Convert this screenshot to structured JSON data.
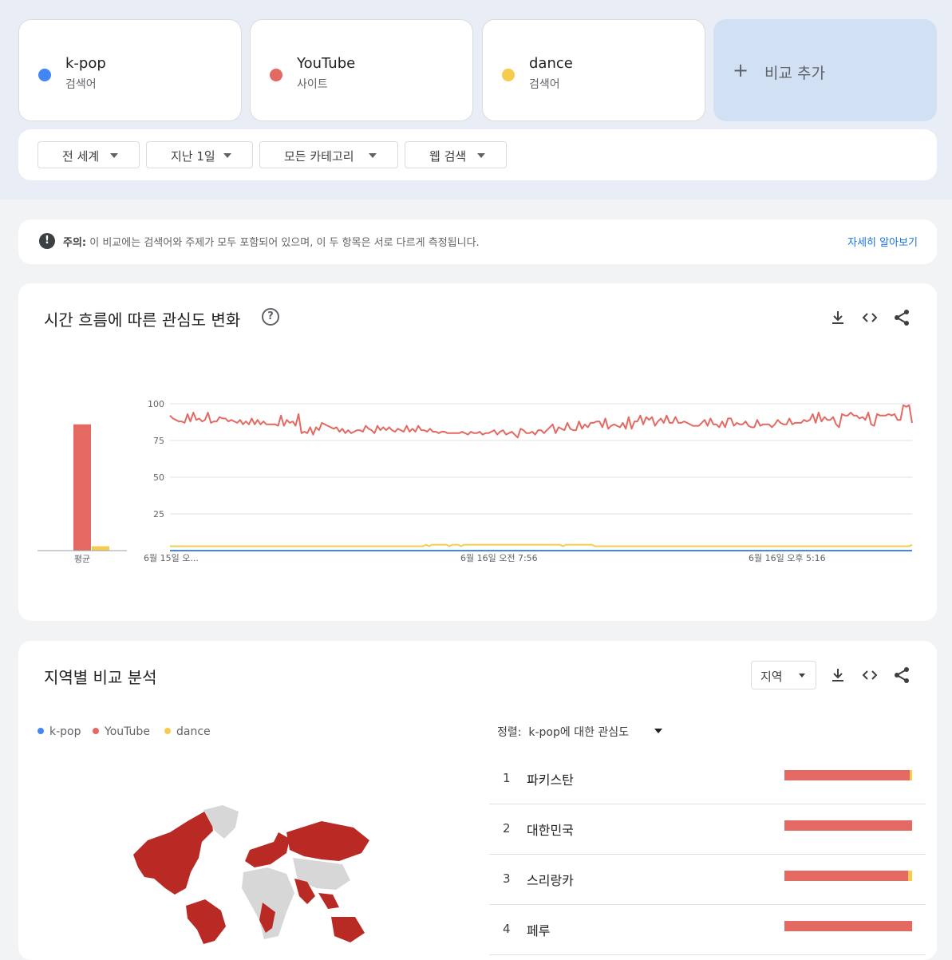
{
  "colors": {
    "kpop": "#4285f4",
    "youtube": "#e46962",
    "dance": "#f7cb4d",
    "accent": "#1a73e8"
  },
  "terms": [
    {
      "name": "k-pop",
      "type": "검색어",
      "color": "#4285f4"
    },
    {
      "name": "YouTube",
      "type": "사이트",
      "color": "#e46962"
    },
    {
      "name": "dance",
      "type": "검색어",
      "color": "#f7cb4d"
    }
  ],
  "add_compare": {
    "icon": "plus-icon",
    "label": "비교 추가"
  },
  "filters": [
    {
      "label": "전 세계"
    },
    {
      "label": "지난 1일"
    },
    {
      "label": "모든 카테고리"
    },
    {
      "label": "웹 검색"
    }
  ],
  "notice": {
    "icon": "exclamation-icon",
    "prefix": "주의:",
    "text": " 이 비교에는 검색어와 주제가 모두 포함되어 있으며, 이 두 항목은 서로 다르게 측정됩니다.",
    "link": "자세히 알아보기"
  },
  "interest_over_time": {
    "title": "시간 흐름에 따른 관심도 변화",
    "help_icon": "help-circle-icon",
    "tools": [
      "download-icon",
      "embed-code-icon",
      "share-icon"
    ]
  },
  "chart_data": {
    "type": "line",
    "y_ticks": [
      "100",
      "75",
      "50",
      "25"
    ],
    "ylim": [
      0,
      100
    ],
    "grid": true,
    "x_tick_labels": [
      "6월 15일 오...",
      "6월 16일 오전 7:56",
      "6월 16일 오후 5:16"
    ],
    "average": {
      "label": "평균",
      "values": [
        {
          "name": "k-pop",
          "value": 0
        },
        {
          "name": "YouTube",
          "value": 86
        },
        {
          "name": "dance",
          "value": 3
        }
      ]
    },
    "series": [
      {
        "name": "YouTube",
        "color": "#e46962",
        "values": [
          92,
          90,
          89,
          88,
          88,
          87,
          93,
          88,
          94,
          89,
          90,
          88,
          89,
          94,
          87,
          88,
          88,
          91,
          90,
          90,
          88,
          89,
          88,
          87,
          89,
          86,
          88,
          86,
          90,
          86,
          89,
          86,
          88,
          86,
          86,
          86,
          86,
          85,
          92,
          85,
          89,
          87,
          88,
          85,
          93,
          80,
          81,
          80,
          84,
          79,
          84,
          82,
          87,
          86,
          85,
          84,
          83,
          84,
          81,
          83,
          80,
          82,
          80,
          81,
          82,
          82,
          81,
          85,
          83,
          82,
          80,
          85,
          82,
          84,
          82,
          84,
          82,
          81,
          83,
          82,
          81,
          85,
          81,
          83,
          81,
          85,
          82,
          82,
          81,
          83,
          81,
          81,
          80,
          81,
          81,
          80,
          80,
          80,
          80,
          80,
          81,
          80,
          79,
          81,
          80,
          80,
          81,
          79,
          80,
          80,
          81,
          82,
          79,
          81,
          82,
          79,
          80,
          81,
          79,
          77,
          83,
          82,
          80,
          80,
          81,
          79,
          82,
          82,
          80,
          82,
          84,
          86,
          80,
          84,
          83,
          82,
          87,
          83,
          82,
          82,
          88,
          83,
          86,
          84,
          87,
          87,
          88,
          88,
          84,
          90,
          83,
          85,
          86,
          85,
          84,
          87,
          83,
          91,
          83,
          88,
          88,
          92,
          86,
          91,
          89,
          91,
          85,
          88,
          90,
          87,
          92,
          87,
          87,
          91,
          87,
          87,
          88,
          87,
          86,
          85,
          85,
          85,
          87,
          89,
          85,
          90,
          86,
          86,
          84,
          88,
          84,
          90,
          90,
          85,
          87,
          86,
          86,
          88,
          85,
          84,
          84,
          89,
          85,
          86,
          86,
          86,
          84,
          86,
          89,
          87,
          86,
          86,
          90,
          86,
          87,
          87,
          87,
          89,
          88,
          89,
          93,
          87,
          94,
          88,
          91,
          89,
          89,
          91,
          86,
          84,
          93,
          92,
          92,
          94,
          92,
          92,
          90,
          91,
          89,
          94,
          86,
          85,
          93,
          92,
          92,
          92,
          93,
          92,
          93,
          89,
          89,
          99,
          98,
          99,
          87
        ]
      },
      {
        "name": "dance",
        "color": "#f7cb4d",
        "values": [
          3,
          3,
          3,
          3,
          3,
          3,
          3,
          3,
          3,
          3,
          3,
          3,
          3,
          3,
          3,
          3,
          3,
          3,
          3,
          3,
          3,
          3,
          3,
          3,
          3,
          3,
          3,
          3,
          3,
          3,
          3,
          3,
          3,
          3,
          3,
          3,
          3,
          3,
          3,
          3,
          3,
          3,
          3,
          3,
          3,
          3,
          3,
          3,
          3,
          3,
          3,
          3,
          3,
          3,
          3,
          3,
          3,
          3,
          3,
          3,
          3,
          3,
          3,
          3,
          3,
          3,
          3,
          3,
          3,
          3,
          3,
          3,
          3,
          3,
          3,
          3,
          3,
          3,
          3,
          3,
          3,
          3,
          3,
          3,
          3,
          3,
          3,
          3,
          4,
          3,
          4,
          4,
          4,
          4,
          4,
          4,
          3,
          4,
          4,
          4,
          3,
          4,
          4,
          4,
          4,
          4,
          4,
          4,
          4,
          4,
          4,
          4,
          4,
          4,
          4,
          4,
          4,
          4,
          4,
          4,
          4,
          4,
          4,
          4,
          4,
          4,
          4,
          4,
          4,
          4,
          4,
          4,
          4,
          4,
          4,
          3,
          4,
          4,
          4,
          4,
          4,
          4,
          4,
          4,
          4,
          4,
          3,
          3,
          3,
          3,
          3,
          3,
          3,
          3,
          3,
          3,
          3,
          3,
          3,
          3,
          3,
          3,
          3,
          3,
          3,
          3,
          3,
          3,
          3,
          3,
          3,
          3,
          3,
          3,
          3,
          3,
          3,
          3,
          3,
          3,
          3,
          3,
          3,
          3,
          3,
          3,
          3,
          3,
          3,
          3,
          3,
          3,
          3,
          3,
          3,
          3,
          3,
          3,
          3,
          3,
          3,
          3,
          3,
          3,
          3,
          3,
          3,
          3,
          3,
          3,
          3,
          3,
          3,
          3,
          3,
          3,
          3,
          3,
          3,
          3,
          3,
          3,
          3,
          3,
          3,
          3,
          3,
          3,
          3,
          3,
          3,
          3,
          3,
          3,
          3,
          3,
          3,
          3,
          3,
          3,
          3,
          3,
          3,
          3,
          3,
          3,
          3,
          3,
          3,
          3,
          3,
          3,
          3,
          3,
          3,
          4
        ]
      },
      {
        "name": "k-pop",
        "color": "#4285f4",
        "values": [
          0,
          0,
          0,
          0,
          0,
          0,
          0,
          0,
          0,
          0,
          0,
          0,
          0,
          0,
          0,
          0,
          0,
          0,
          0,
          0
        ]
      }
    ]
  },
  "regional": {
    "title": "지역별 비교 분석",
    "region_select": "지역",
    "tools": [
      "download-icon",
      "embed-code-icon",
      "share-icon"
    ],
    "legend": [
      "k-pop",
      "YouTube",
      "dance"
    ],
    "sort_prefix": "정렬:",
    "sort_value": "k-pop에 대한 관심도",
    "rows": [
      {
        "rank": "1",
        "name": "파키스탄",
        "youtube": 0.98,
        "dance": 0.02
      },
      {
        "rank": "2",
        "name": "대한민국",
        "youtube": 1.0,
        "dance": 0
      },
      {
        "rank": "3",
        "name": "스리랑카",
        "youtube": 0.97,
        "dance": 0.03
      },
      {
        "rank": "4",
        "name": "페루",
        "youtube": 1.0,
        "dance": 0
      }
    ]
  }
}
